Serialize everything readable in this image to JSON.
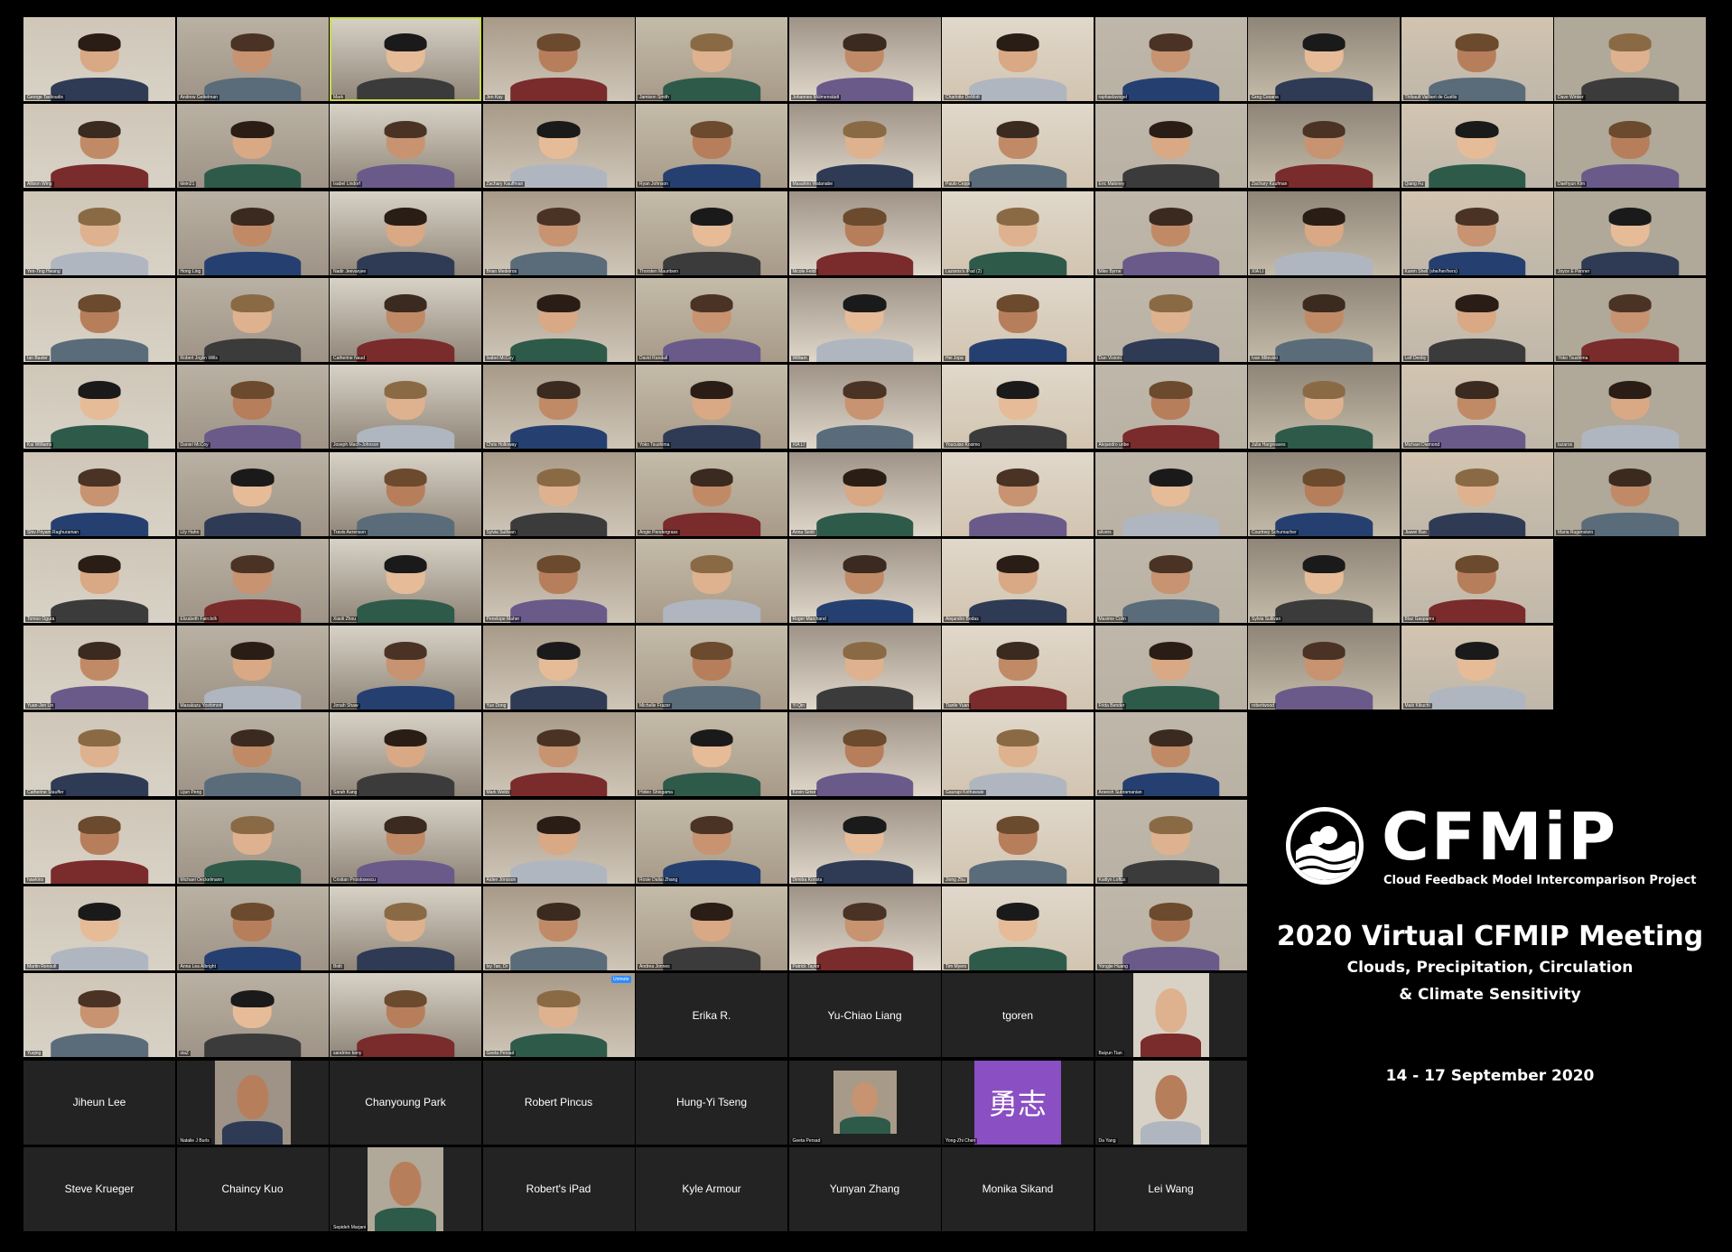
{
  "branding": {
    "logo_text": "CFMiP",
    "logo_subtitle": "Cloud Feedback Model Intercomparison Project",
    "meeting_title": "2020 Virtual CFMIP Meeting",
    "meeting_subtitle_1": "Clouds, Precipitation, Circulation",
    "meeting_subtitle_2": "& Climate Sensitivity",
    "dates": "14 - 17 September 2020"
  },
  "gallery": {
    "rows": [
      [
        {
          "name": "George Tselioudis",
          "kind": "video"
        },
        {
          "name": "Andrew Gettelman",
          "kind": "video"
        },
        {
          "name": "Mark",
          "kind": "video",
          "highlight": true
        },
        {
          "name": "Jen Kay",
          "kind": "video"
        },
        {
          "name": "Jamison Smith",
          "kind": "video"
        },
        {
          "name": "Johannes Mülmenstädt",
          "kind": "video"
        },
        {
          "name": "Charlotte DeMott",
          "kind": "video"
        },
        {
          "name": "raphaelavogel",
          "kind": "video"
        },
        {
          "name": "Greg Cesana",
          "kind": "video"
        },
        {
          "name": "Thibault Vaillant de Guélis",
          "kind": "video"
        },
        {
          "name": "Dave Winker",
          "kind": "video"
        }
      ],
      [
        {
          "name": "Allison Wing",
          "kind": "video"
        },
        {
          "name": "klein21",
          "kind": "video"
        },
        {
          "name": "Isabel Lindorf",
          "kind": "video"
        },
        {
          "name": "Zachary Kauffman",
          "kind": "video"
        },
        {
          "name": "Ryan Johnson",
          "kind": "video"
        },
        {
          "name": "Masahiro Watanabe",
          "kind": "video"
        },
        {
          "name": "Paulo Ceppi",
          "kind": "video"
        },
        {
          "name": "Eric Maloney",
          "kind": "video"
        },
        {
          "name": "Zachary Kaufman",
          "kind": "video"
        },
        {
          "name": "Qiang Fu",
          "kind": "video"
        },
        {
          "name": "Daehyun Kim",
          "kind": "video"
        }
      ],
      [
        {
          "name": "Yen-Ting Hwang",
          "kind": "video"
        },
        {
          "name": "Hong Ling",
          "kind": "video"
        },
        {
          "name": "Nadir Jeevanjee",
          "kind": "video"
        },
        {
          "name": "Brian Medeiros",
          "kind": "video"
        },
        {
          "name": "Thorsten Mauritsen",
          "kind": "video"
        },
        {
          "name": "Nicole Feldl",
          "kind": "video"
        },
        {
          "name": "Lazaros's iPad (2)",
          "kind": "video"
        },
        {
          "name": "Mike Byrne",
          "kind": "video"
        },
        {
          "name": "XIA LI",
          "kind": "video"
        },
        {
          "name": "Karen Shell (she/her/hers)",
          "kind": "video"
        },
        {
          "name": "Joyce E Penner",
          "kind": "video"
        }
      ],
      [
        {
          "name": "Ian Baxter",
          "kind": "video"
        },
        {
          "name": "Robert Jnglin Wills",
          "kind": "video"
        },
        {
          "name": "Catherine Naud",
          "kind": "video"
        },
        {
          "name": "Isabel McCoy",
          "kind": "video"
        },
        {
          "name": "David Randall",
          "kind": "video"
        },
        {
          "name": "William",
          "kind": "video"
        },
        {
          "name": "Hei Jopa",
          "kind": "video"
        },
        {
          "name": "Dan Visioni",
          "kind": "video"
        },
        {
          "name": "Ivan Mitevski",
          "kind": "video"
        },
        {
          "name": "Leif Denby",
          "kind": "video"
        },
        {
          "name": "Yoko Tsushima",
          "kind": "video"
        }
      ],
      [
        {
          "name": "Kai Williams",
          "kind": "video"
        },
        {
          "name": "Daniel McCoy",
          "kind": "video"
        },
        {
          "name": "Joseph Mach-Johnson",
          "kind": "video"
        },
        {
          "name": "Chris Holloway",
          "kind": "video"
        },
        {
          "name": "Yoko Tsushima",
          "kind": "video"
        },
        {
          "name": "XIA LI",
          "kind": "video"
        },
        {
          "name": "Youcuiso Kosimo",
          "kind": "video"
        },
        {
          "name": "Alejandro uribe",
          "kind": "video"
        },
        {
          "name": "Julia Hargreaves",
          "kind": "video"
        },
        {
          "name": "Michael Diamond",
          "kind": "video"
        },
        {
          "name": "lazaros",
          "kind": "video"
        }
      ],
      [
        {
          "name": "Shiv Priyam Raghuraman",
          "kind": "video"
        },
        {
          "name": "Lily Hahn",
          "kind": "video"
        },
        {
          "name": "Travis Aerenson",
          "kind": "video"
        },
        {
          "name": "Sylvia Sullivan",
          "kind": "video"
        },
        {
          "name": "Angie Pendergrass",
          "kind": "video"
        },
        {
          "name": "Anna Seidi",
          "kind": "video"
        },
        {
          "name": "",
          "kind": "video"
        },
        {
          "name": "silvers",
          "kind": "video"
        },
        {
          "name": "Courtney Schumacher",
          "kind": "video"
        },
        {
          "name": "Jiawei Bao",
          "kind": "video"
        },
        {
          "name": "Maria Rugenstein",
          "kind": "video"
        }
      ],
      [
        {
          "name": "Tomoo Ogura",
          "kind": "video"
        },
        {
          "name": "Elizabeth Fairclolh",
          "kind": "video"
        },
        {
          "name": "Xiaoli Zhou",
          "kind": "video"
        },
        {
          "name": "Penelope Maher",
          "kind": "video"
        },
        {
          "name": "",
          "kind": "video"
        },
        {
          "name": "Roger Marchand",
          "kind": "video"
        },
        {
          "name": "Alejandro Bodas",
          "kind": "video"
        },
        {
          "name": "Maxime Colin",
          "kind": "video"
        },
        {
          "name": "Sylvia Sullivan",
          "kind": "video"
        },
        {
          "name": "Blaz Gasparini",
          "kind": "video"
        }
      ],
      [
        {
          "name": "Yuan-Jen Lin",
          "kind": "video"
        },
        {
          "name": "Masakazu Yoshimori",
          "kind": "video"
        },
        {
          "name": "Jonah Shaw",
          "kind": "video"
        },
        {
          "name": "Yue Dong",
          "kind": "video"
        },
        {
          "name": "Michelle Frazer",
          "kind": "video"
        },
        {
          "name": "Yi Qin",
          "kind": "video"
        },
        {
          "name": "Tianle Yuan",
          "kind": "video"
        },
        {
          "name": "Frida Bender",
          "kind": "video"
        },
        {
          "name": "robertwood",
          "kind": "video"
        },
        {
          "name": "Maki Kikuchi",
          "kind": "video"
        }
      ],
      [
        {
          "name": "Catherine Stauffer",
          "kind": "video"
        },
        {
          "name": "Lijun Peng",
          "kind": "video"
        },
        {
          "name": "Sarah Kang",
          "kind": "video"
        },
        {
          "name": "Mark Webb",
          "kind": "video"
        },
        {
          "name": "Hideo Shiogama",
          "kind": "video"
        },
        {
          "name": "Kevin Grise",
          "kind": "video"
        },
        {
          "name": "Gaurapi Kothawale",
          "kind": "video"
        },
        {
          "name": "Aneesh Subramanian",
          "kind": "video"
        }
      ],
      [
        {
          "name": "hawkins",
          "kind": "video"
        },
        {
          "name": "Michael Oeckelmann",
          "kind": "video"
        },
        {
          "name": "Cristian Proistosescu",
          "kind": "video"
        },
        {
          "name": "Aiden Jönsson",
          "kind": "video"
        },
        {
          "name": "Rosie Dallai Zhang",
          "kind": "video"
        },
        {
          "name": "Dimitra Konsta",
          "kind": "video"
        },
        {
          "name": "Jiong Zhu",
          "kind": "video"
        },
        {
          "name": "Kaitlyn Loftus",
          "kind": "video"
        }
      ],
      [
        {
          "name": "Martin Renoult",
          "kind": "video"
        },
        {
          "name": "Anna Lea Albright",
          "kind": "video"
        },
        {
          "name": "Bidit",
          "kind": "video"
        },
        {
          "name": "Ivy Tan, Dr",
          "kind": "video"
        },
        {
          "name": "Andrea Jonnes",
          "kind": "video"
        },
        {
          "name": "Patrick Taylor",
          "kind": "video"
        },
        {
          "name": "Tim Myers",
          "kind": "video"
        },
        {
          "name": "Yongjie Huang",
          "kind": "video"
        }
      ],
      [
        {
          "name": "Yuqing",
          "kind": "video"
        },
        {
          "name": "xiaZ",
          "kind": "video"
        },
        {
          "name": "sandrine bony",
          "kind": "video"
        },
        {
          "name": "Geeta Persad",
          "kind": "video",
          "badge": "Unmute"
        },
        {
          "name": "Erika R.",
          "kind": "name"
        },
        {
          "name": "Yu-Chiao Liang",
          "kind": "name"
        },
        {
          "name": "tgoren",
          "kind": "name"
        },
        {
          "name": "Baiyun Tian",
          "kind": "photo"
        }
      ],
      [
        {
          "name": "Jiheun Lee",
          "kind": "name"
        },
        {
          "name": "Natalie J Burls",
          "kind": "photo"
        },
        {
          "name": "Chanyoung Park",
          "kind": "name"
        },
        {
          "name": "Robert Pincus",
          "kind": "name"
        },
        {
          "name": "Hung-Yi Tseng",
          "kind": "name"
        },
        {
          "name": "Geeta Persad",
          "kind": "photo-small"
        },
        {
          "name": "Yong-Zhi Chen",
          "kind": "avatar",
          "avatar_text": "勇志"
        },
        {
          "name": "Da Yang",
          "kind": "photo"
        }
      ],
      [
        {
          "name": "Steve Krueger",
          "kind": "name"
        },
        {
          "name": "Chaincy Kuo",
          "kind": "name"
        },
        {
          "name": "Sepideh Marjani",
          "kind": "photo"
        },
        {
          "name": "Robert's iPad",
          "kind": "name"
        },
        {
          "name": "Kyle Armour",
          "kind": "name"
        },
        {
          "name": "Yunyan Zhang",
          "kind": "name"
        },
        {
          "name": "Monika Sikand",
          "kind": "name"
        },
        {
          "name": "Lei Wang",
          "kind": "name"
        }
      ]
    ]
  }
}
